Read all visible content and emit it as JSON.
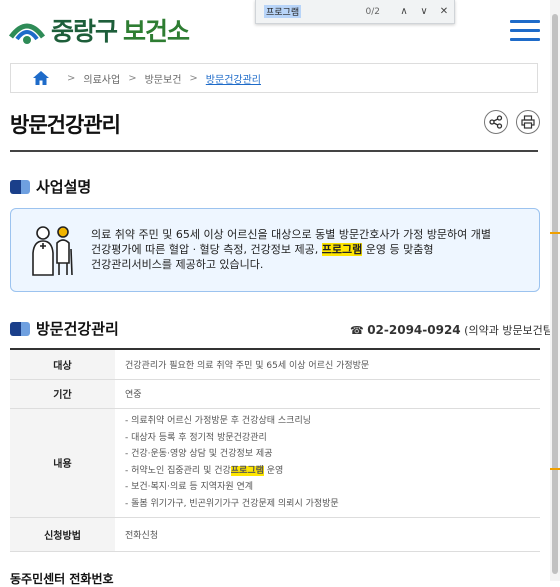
{
  "header": {
    "logo_main": "중랑구",
    "logo_sub": "보건소"
  },
  "findbar": {
    "query": "프로그램",
    "count": "0/2",
    "prev": "∧",
    "next": "∨",
    "close": "✕"
  },
  "breadcrumb": {
    "items": [
      "의료사업",
      "방문보건"
    ],
    "current": "방문건강관리",
    "sep": ">"
  },
  "page": {
    "title": "방문건강관리"
  },
  "section1": {
    "title": "사업설명",
    "desc_lines": [
      "의료 취약 주민 및 65세 이상 어르신을 대상으로 동별 방문간호사가 가정 방문하여 개별",
      "건강평가에 따른 혈압 · 혈당 측정, 건강정보 제공, ",
      "프로그램",
      " 운영 등 맞춤형",
      "건강관리서비스를 제공하고 있습니다."
    ]
  },
  "section2": {
    "title": "방문건강관리",
    "phone": "02-2094-0924",
    "phone_note": "(의약과 방문보건팀)",
    "rows": [
      {
        "label": "대상",
        "value": "건강관리가 필요한 의료 취약 주민 및 65세 이상 어르신 가정방문"
      },
      {
        "label": "기간",
        "value": "연중"
      },
      {
        "label": "내용",
        "items": [
          "- 의료취약 어르신 가정방문 후 건강상태 스크리닝",
          "- 대상자 등록 후 정기적 방문건강관리",
          "- 건강·운동·영양 상담 및 건강정보 제공",
          "- 허약노인 집중관리 및 건강",
          "프로그램",
          " 운영",
          "- 보건·복지·의료 등 지역자원 연계",
          "- 돌봄 위기가구, 빈곤위기가구 건강문제 의뢰시 가정방문"
        ]
      },
      {
        "label": "신청방법",
        "value": "전화신청"
      }
    ]
  },
  "section3": {
    "title": "동주민센터 전화번호"
  },
  "colors": {
    "accent": "#1e6bc9",
    "brand": "#1d5e3a",
    "highlight": "#ffe600"
  }
}
